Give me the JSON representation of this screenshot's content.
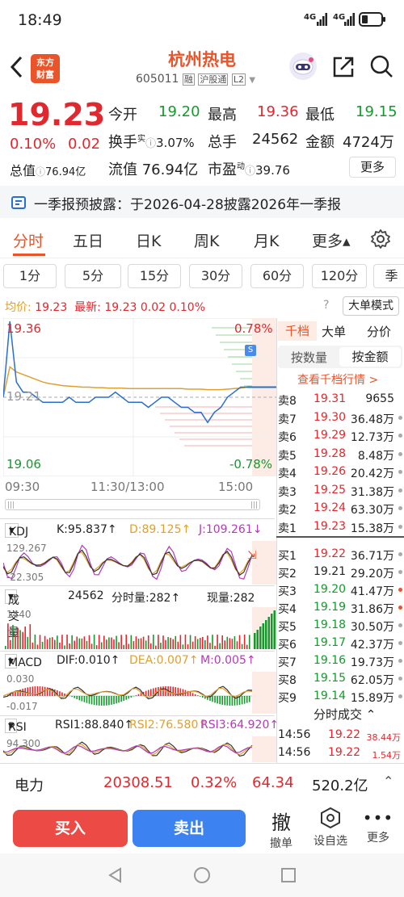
{
  "status": {
    "time": "18:49",
    "net1": "4G",
    "net2": "4G"
  },
  "header": {
    "logo_line1": "东方",
    "logo_line2": "财富",
    "title": "杭州热电",
    "code": "605011",
    "tag_rong": "融",
    "tag_hgt": "沪股通",
    "tag_l2": "L2"
  },
  "quote": {
    "price": "19.23",
    "pct": "0.10%",
    "chg": "0.02",
    "open_label": "今开",
    "open": "19.20",
    "high_label": "最高",
    "high": "19.36",
    "low_label": "最低",
    "low": "19.15",
    "turnover_label": "换手",
    "turnover_sup": "实",
    "turnover": "3.07%",
    "vol_label": "总手",
    "vol": "24562",
    "amount_label": "金额",
    "amount": "4724万",
    "mcap_label": "总值",
    "mcap": "76.94亿",
    "float_label": "流值",
    "float": "76.94亿",
    "pe_label": "市盈",
    "pe_sup": "动",
    "pe": "39.76",
    "more": "更多"
  },
  "notice": {
    "text": "一季报预披露：于2026-04-28披露2026年一季报"
  },
  "tabs": [
    "分时",
    "五日",
    "日K",
    "周K",
    "月K",
    "更多▴"
  ],
  "periods": [
    "1分",
    "5分",
    "15分",
    "30分",
    "60分",
    "120分",
    "季"
  ],
  "chart_info": {
    "avg_label": "均价:",
    "avg": "19.23",
    "last_label": "最新:",
    "last": "19.23",
    "chg": "0.02",
    "pct": "0.10%",
    "big_order": "大单模式"
  },
  "chart_data": {
    "type": "line",
    "y_max": "19.36",
    "y_mid": "19.21",
    "y_min": "19.06",
    "pct_max": "0.78%",
    "pct_min": "-0.78%",
    "x_labels": [
      "09:30",
      "11:30/13:00",
      "15:00"
    ],
    "ylim": [
      19.06,
      19.36
    ],
    "series": [
      {
        "values": [
          19.21,
          19.36,
          19.24,
          19.22,
          19.22,
          19.21,
          19.2,
          19.2,
          19.2,
          19.2,
          19.21,
          19.2,
          19.2,
          19.2,
          19.21,
          19.21,
          19.21,
          19.22,
          19.21,
          19.2,
          19.2,
          19.2,
          19.19,
          19.2,
          19.21,
          19.21,
          19.2,
          19.19,
          19.19,
          19.18,
          19.18,
          19.16,
          19.18,
          19.19,
          19.21,
          19.22,
          19.23,
          19.23
        ]
      },
      {
        "values": [
          19.21,
          19.27,
          19.26,
          19.255,
          19.25,
          19.245,
          19.24,
          19.237,
          19.235,
          19.233,
          19.232,
          19.231,
          19.23,
          19.23,
          19.229,
          19.229,
          19.228,
          19.228,
          19.228,
          19.227,
          19.227,
          19.227,
          19.227,
          19.227,
          19.227,
          19.227,
          19.227,
          19.227,
          19.226,
          19.226,
          19.226,
          19.225,
          19.225,
          19.225,
          19.226,
          19.227,
          19.228,
          19.23
        ]
      }
    ]
  },
  "orderbook": {
    "tabs": [
      "千档",
      "大单",
      "分价"
    ],
    "modes": [
      "按数量",
      "按金额"
    ],
    "link": "查看千档行情 >",
    "sells": [
      {
        "label": "卖8",
        "price": "19.31",
        "vol": "9655"
      },
      {
        "label": "卖7",
        "price": "19.30",
        "vol": "36.48万"
      },
      {
        "label": "卖6",
        "price": "19.29",
        "vol": "12.73万"
      },
      {
        "label": "卖5",
        "price": "19.28",
        "vol": "8.48万"
      },
      {
        "label": "卖4",
        "price": "19.26",
        "vol": "20.42万"
      },
      {
        "label": "卖3",
        "price": "19.25",
        "vol": "31.38万"
      },
      {
        "label": "卖2",
        "price": "19.24",
        "vol": "63.30万"
      },
      {
        "label": "卖1",
        "price": "19.23",
        "vol": "15.38万"
      }
    ],
    "buys": [
      {
        "label": "买1",
        "price": "19.22",
        "vol": "36.71万"
      },
      {
        "label": "买2",
        "price": "19.21",
        "vol": "29.20万"
      },
      {
        "label": "买3",
        "price": "19.20",
        "vol": "41.47万"
      },
      {
        "label": "买4",
        "price": "19.19",
        "vol": "31.86万"
      },
      {
        "label": "买5",
        "price": "19.18",
        "vol": "30.50万"
      },
      {
        "label": "买6",
        "price": "19.17",
        "vol": "42.37万"
      },
      {
        "label": "买7",
        "price": "19.16",
        "vol": "19.73万"
      },
      {
        "label": "买8",
        "price": "19.15",
        "vol": "62.05万"
      },
      {
        "label": "买9",
        "price": "19.14",
        "vol": "15.89万"
      }
    ],
    "ticks_label": "分时成交",
    "ticks": [
      {
        "time": "14:56",
        "price": "19.22",
        "vol": "38.44万"
      },
      {
        "time": "14:56",
        "price": "19.22",
        "vol": "1.54万"
      }
    ]
  },
  "indicators": {
    "kdj": {
      "name": "KDJ",
      "k": "K:95.837↑",
      "d": "D:89.125↑",
      "j": "J:109.261↓",
      "top": "129.267",
      "bottom": "-22.305"
    },
    "vol": {
      "name": "成交量",
      "total": "24562",
      "tick_label": "分时量:282↑",
      "now_label": "现量:282",
      "top": "1440"
    },
    "macd": {
      "name": "MACD",
      "dif": "DIF:0.010↑",
      "dea": "DEA:0.007↑",
      "m": "M:0.005↑",
      "top": "0.030",
      "bottom": "-0.017"
    },
    "rsi": {
      "name": "RSI",
      "r1": "RSI1:88.840↑",
      "r2": "RSI2:76.580↑",
      "r3": "RSI3:64.920↑",
      "top": "94.300"
    }
  },
  "index_bar": {
    "name": "电力",
    "value": "20308.51",
    "pct": "0.32%",
    "chg": "64.34",
    "amount": "520.2亿"
  },
  "actions": {
    "buy": "买入",
    "sell": "卖出",
    "cancel": "撤单",
    "cancel_icon": "撤",
    "watch": "设自选",
    "more": "更多"
  },
  "colors": {
    "up": "#e0282e",
    "down": "#149a2c",
    "price_line": "#2a6fcf",
    "avg_line": "#e0a030",
    "accent": "#e9542a"
  }
}
